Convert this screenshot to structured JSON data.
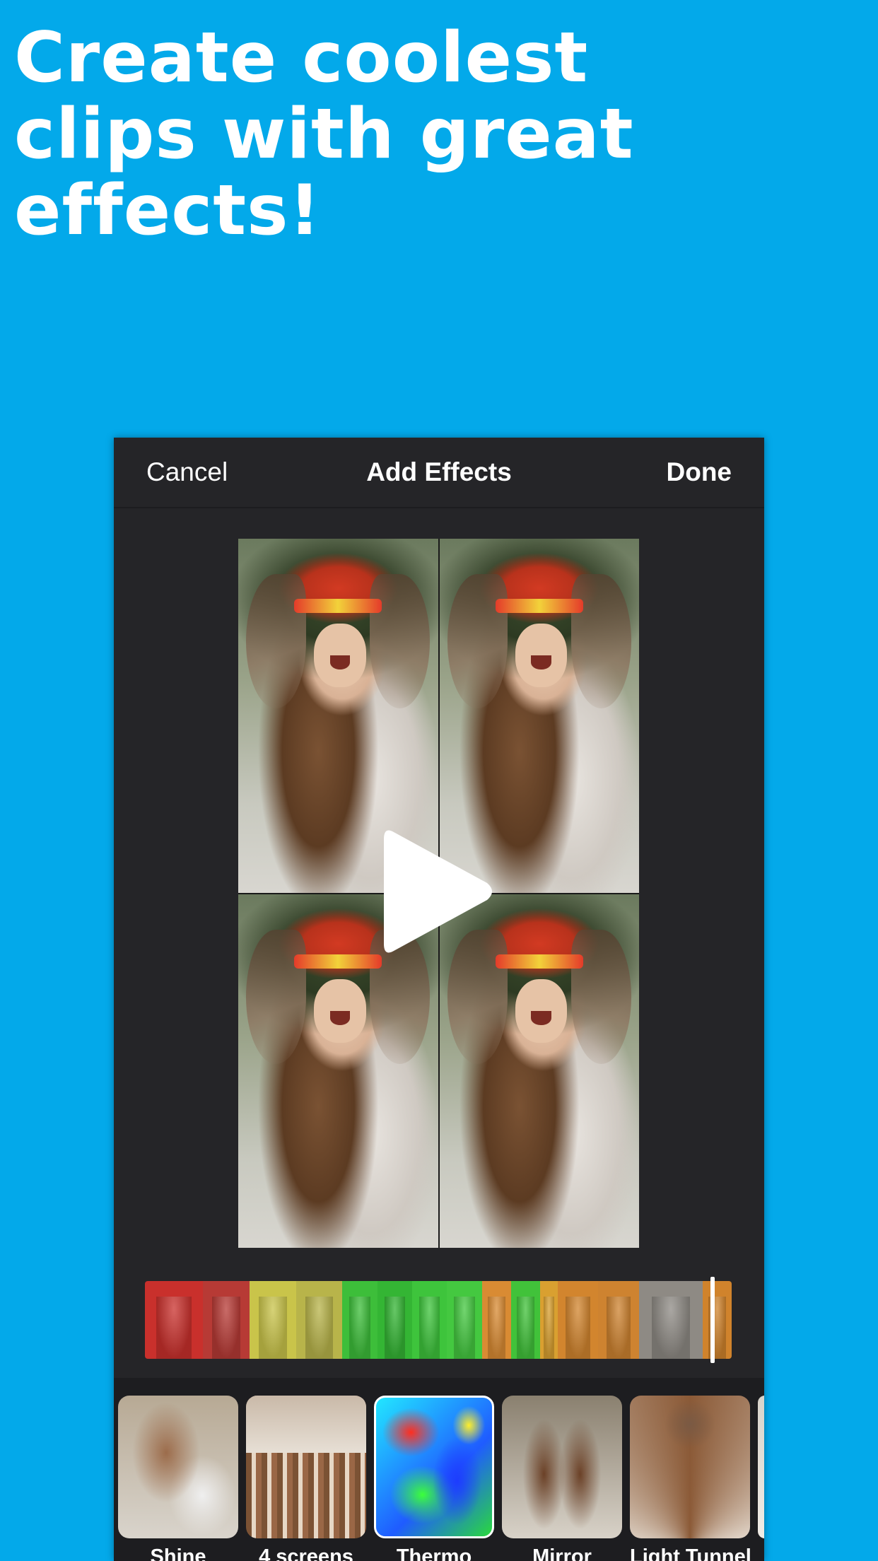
{
  "headline": {
    "lines": [
      "Create coolest",
      "clips with great",
      "effects!"
    ]
  },
  "navbar": {
    "cancel_label": "Cancel",
    "title": "Add Effects",
    "done_label": "Done"
  },
  "colors": {
    "background": "#03A9EA",
    "app_background": "#252528",
    "text": "#FFFFFF"
  },
  "preview": {
    "layout": "4 screens",
    "play_icon": "play-icon"
  },
  "timeline": {
    "segments": [
      {
        "color": "#C9302C",
        "flex": 1
      },
      {
        "color": "#B73A35",
        "flex": 0.8
      },
      {
        "color": "#C9C44A",
        "flex": 0.8
      },
      {
        "color": "#B8B44A",
        "flex": 0.8
      },
      {
        "color": "#3DBE3A",
        "flex": 0.6
      },
      {
        "color": "#34B534",
        "flex": 0.6
      },
      {
        "color": "#3EC43C",
        "flex": 0.6
      },
      {
        "color": "#44C840",
        "flex": 0.6
      },
      {
        "color": "#D98B33",
        "flex": 0.5
      },
      {
        "color": "#41C23A",
        "flex": 0.5
      },
      {
        "color": "#D9A030",
        "flex": 0.3
      },
      {
        "color": "#D2852E",
        "flex": 0.7
      },
      {
        "color": "#CE8330",
        "flex": 0.7
      },
      {
        "color": "#8E8A84",
        "flex": 1.1
      },
      {
        "color": "#D0832C",
        "flex": 0.5
      }
    ]
  },
  "effects": [
    {
      "label": "Shine",
      "thumb": "thumb-shine"
    },
    {
      "label": "4 screens",
      "thumb": "thumb-4screens"
    },
    {
      "label": "Thermo",
      "thumb": "thumb-thermo"
    },
    {
      "label": "Mirror",
      "thumb": "thumb-mirror"
    },
    {
      "label": "Light Tunnel",
      "thumb": "thumb-tunnel"
    }
  ]
}
